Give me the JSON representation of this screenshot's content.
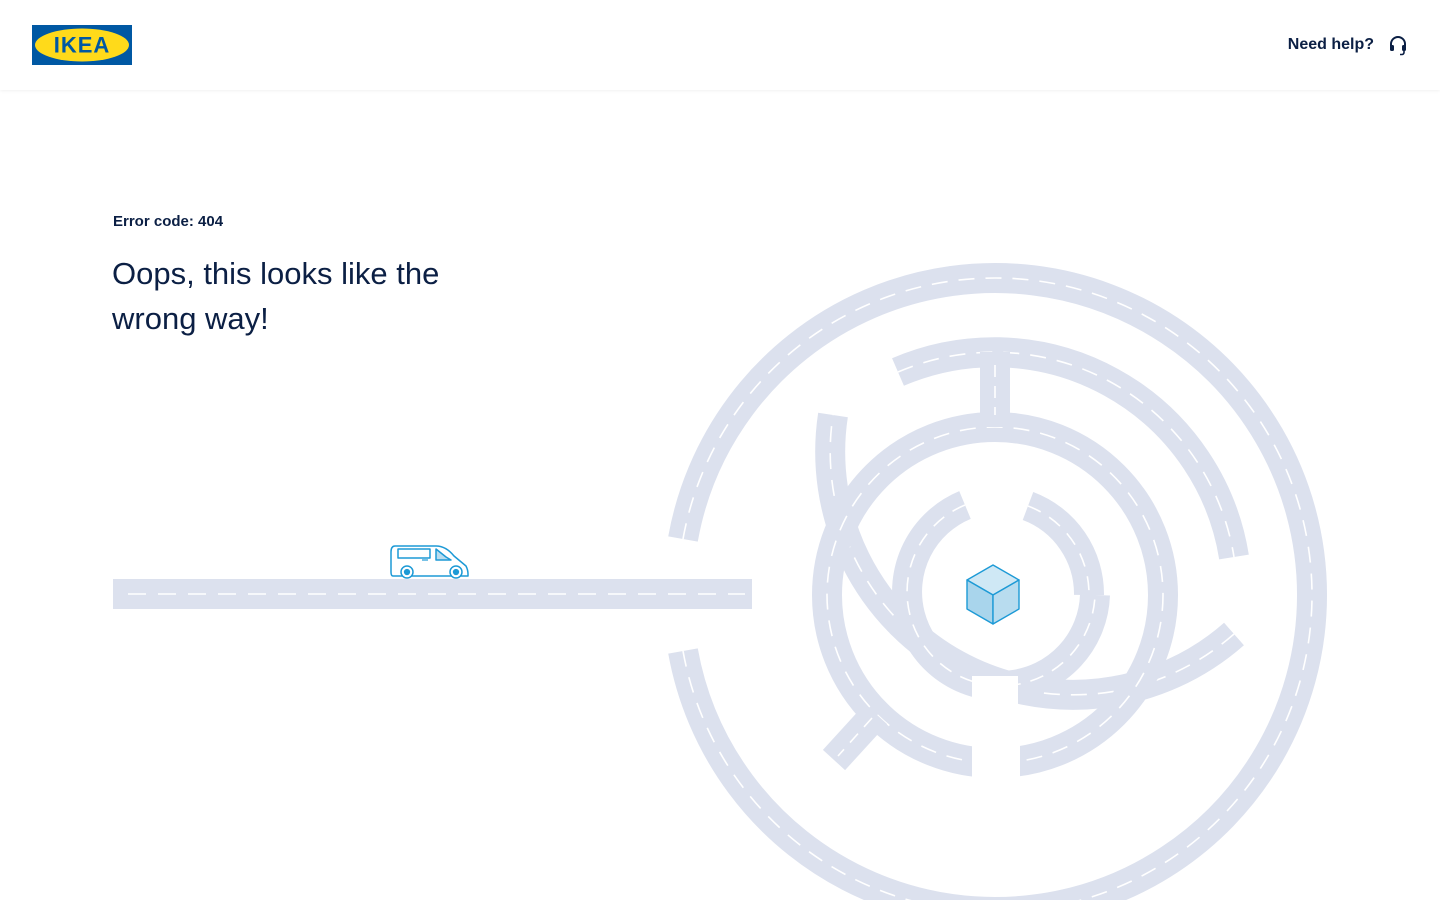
{
  "header": {
    "logo_text": "IKEA",
    "help_label": "Need help?",
    "help_icon": "headset-icon"
  },
  "main": {
    "error_code": "Error code: 404",
    "headline": "Oops, this looks like the wrong way!"
  },
  "illustration": {
    "vehicle_icon": "delivery-van-icon",
    "goal_icon": "package-box-icon"
  },
  "colors": {
    "brand_blue": "#0058a3",
    "brand_yellow": "#ffda1a",
    "text": "#0b1f44",
    "road": "#dce1ee",
    "road_dash": "#ffffff",
    "icon_blue": "#1d9ad6",
    "box_fill": "#b8dcef"
  }
}
